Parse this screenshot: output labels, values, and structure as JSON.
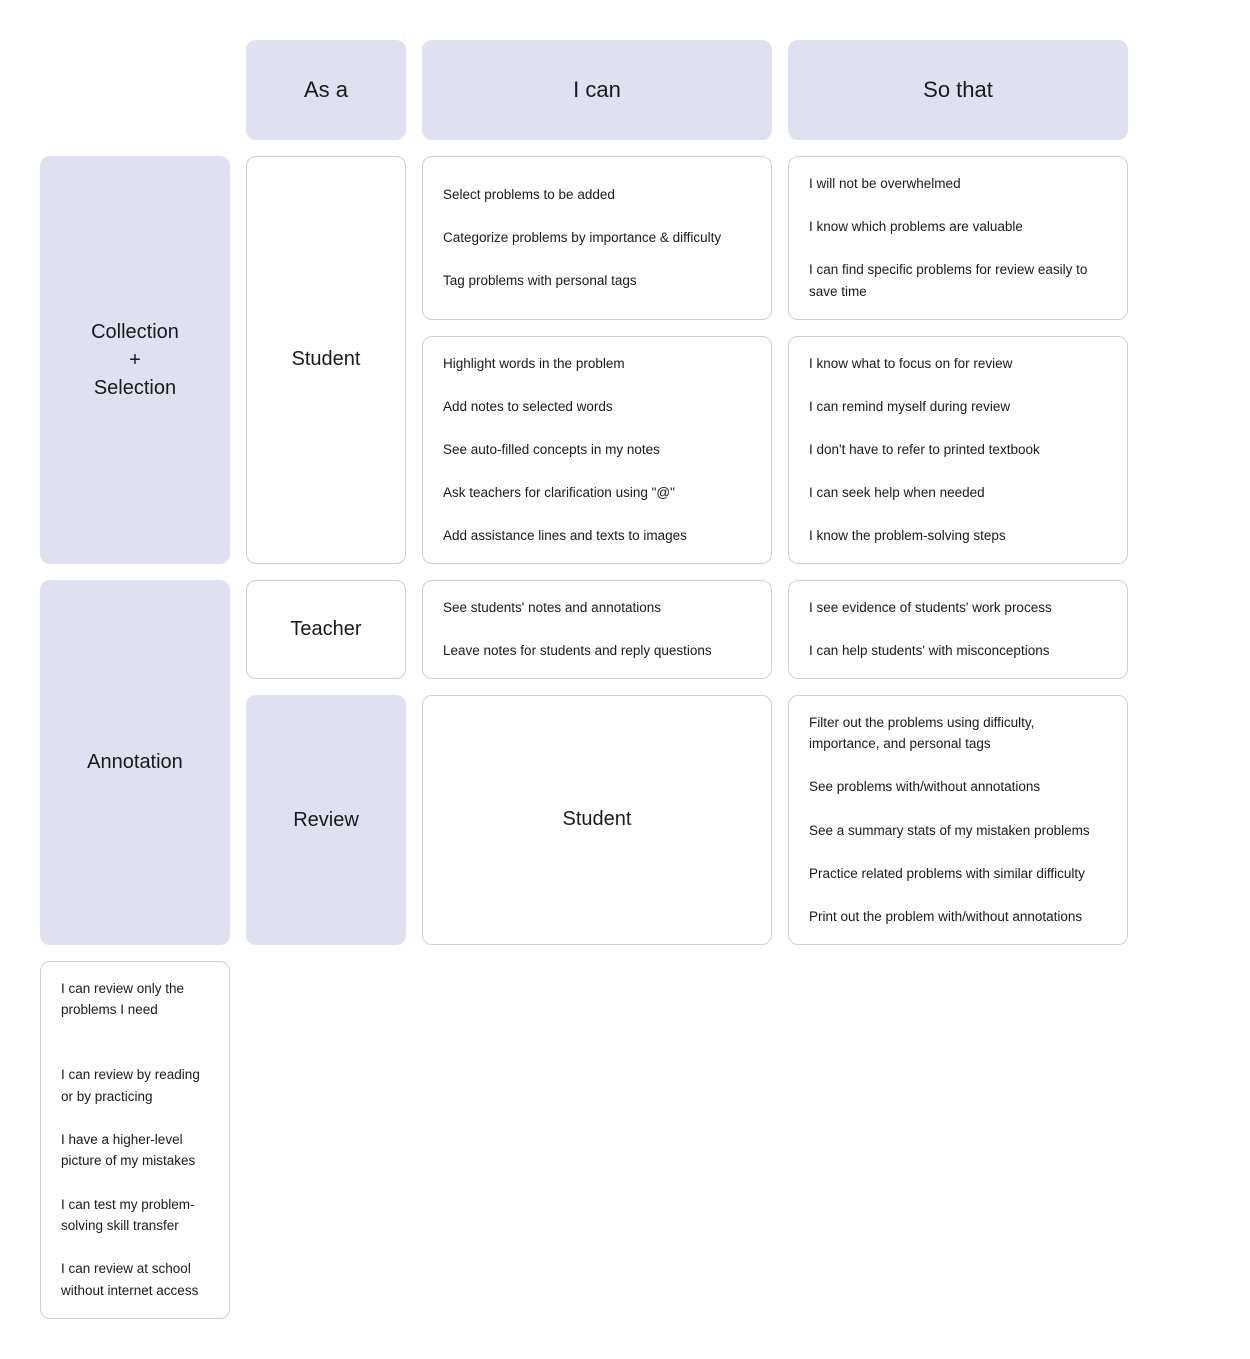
{
  "headers": {
    "col1": "",
    "col2": "As a",
    "col3": "I can",
    "col4": "So that"
  },
  "rows": [
    {
      "category": "Collection\n+\nSelection",
      "personas": [
        {
          "name": "Student",
          "rowspan": 2,
          "ican_rows": [
            {
              "items": [
                "Select problems to be added",
                "Categorize problems by importance & difficulty",
                "Tag problems with personal tags"
              ],
              "sothat_items": [
                "I will not be overwhelmed",
                "I know which problems are valuable",
                "I can find specific problems for review easily to save time"
              ]
            },
            {
              "items": [
                "Highlight words in the problem",
                "Add notes to selected words",
                "See auto-filled concepts in my notes",
                "Ask teachers for clarification using \"@\"",
                "Add assistance lines and texts to images"
              ],
              "sothat_items": [
                "I know what to focus on for review",
                "I can remind myself during review",
                "I don't have to refer to printed textbook",
                "I can seek help when needed",
                "I know the problem-solving steps"
              ]
            }
          ]
        }
      ]
    }
  ],
  "annotation_row": {
    "category": "Annotation",
    "teacher_ican": [
      "See students' notes and annotations",
      "Leave notes for students and reply questions"
    ],
    "teacher_sothat": [
      "I see evidence of students' work process",
      "I can help students' with misconceptions"
    ]
  },
  "review_row": {
    "category": "Review",
    "persona": "Student",
    "ican": [
      "Filter out the problems using difficulty, importance, and personal tags",
      "See problems with/without annotations",
      "See a summary stats of my mistaken problems",
      "Practice related problems with similar difficulty",
      "Print out the problem with/without annotations"
    ],
    "sothat": [
      "I can review only the problems I need",
      "",
      "I can review by reading or by practicing",
      "I have a higher-level picture of my mistakes",
      "I can test my problem-solving skill transfer",
      "I can review at school without internet access"
    ]
  }
}
